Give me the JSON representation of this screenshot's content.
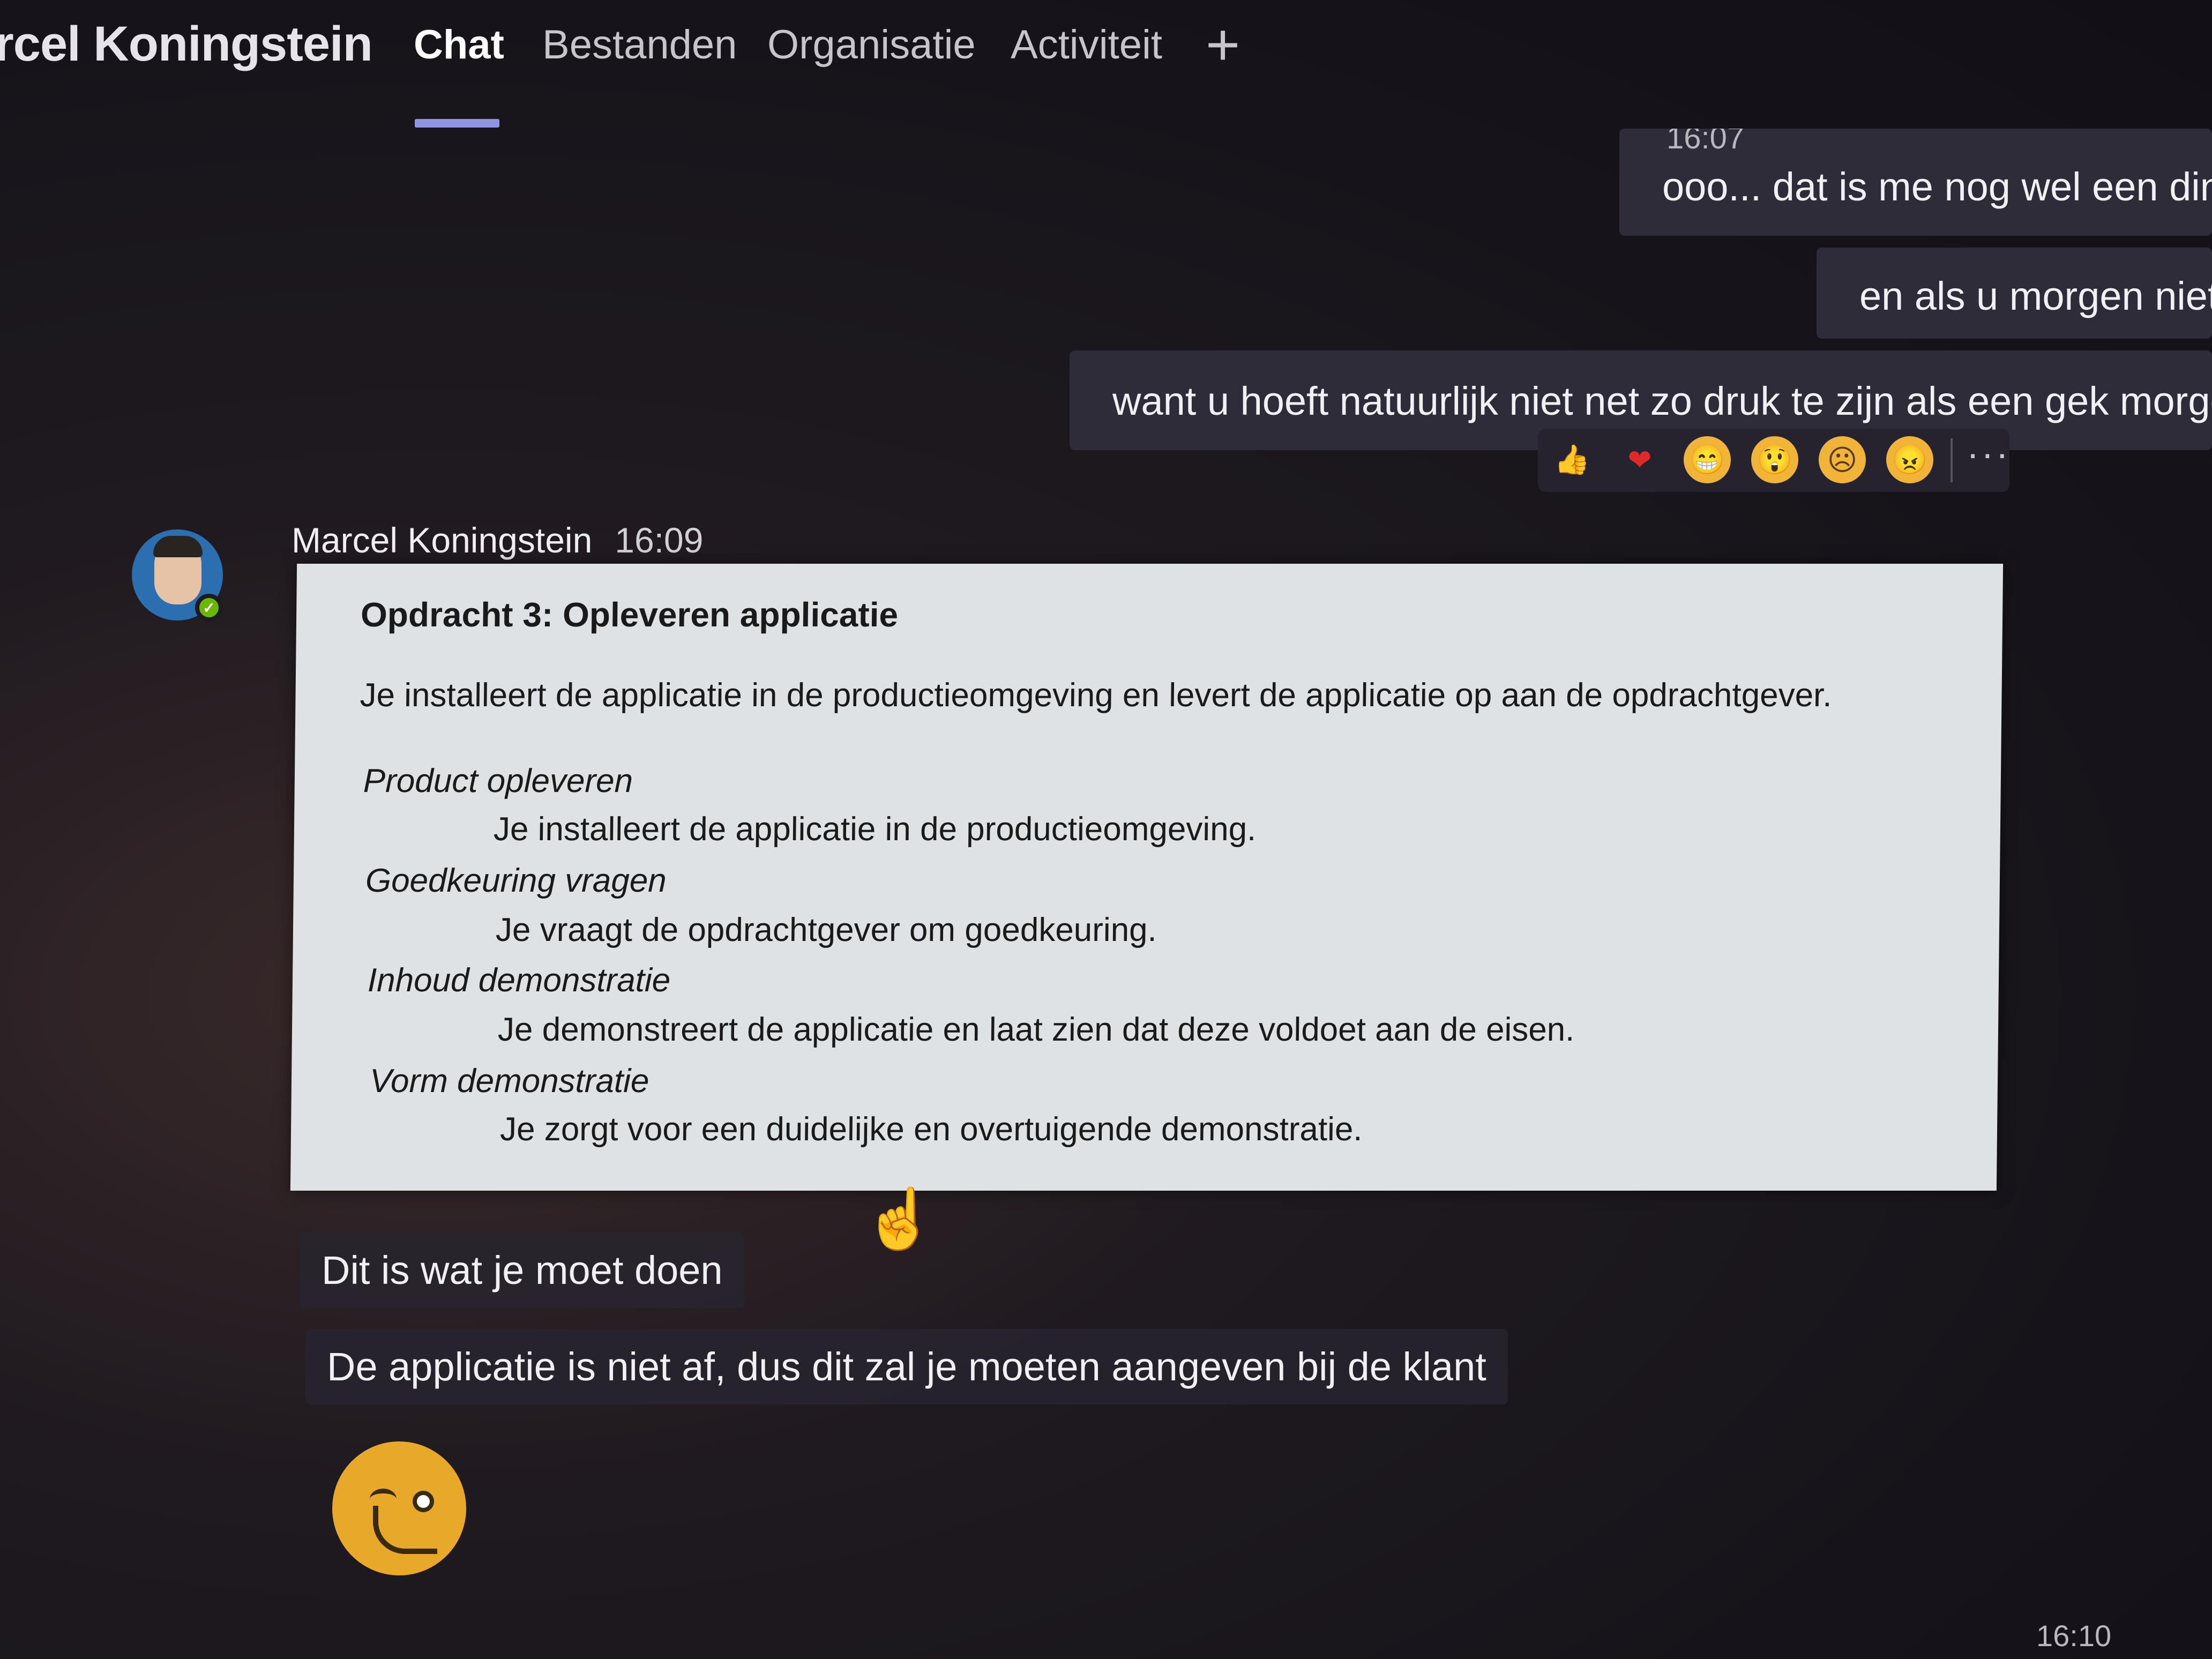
{
  "header": {
    "title": "rcel Koningstein",
    "tabs": [
      {
        "label": "Chat",
        "active": true
      },
      {
        "label": "Bestanden"
      },
      {
        "label": "Organisatie"
      },
      {
        "label": "Activiteit"
      }
    ],
    "add_tab_symbol": "+"
  },
  "messages_sent": [
    {
      "time": "16:07",
      "text": "ooo... dat is me nog wel een ding"
    },
    {
      "text": "en als u morgen niet"
    },
    {
      "text": "want u hoeft natuurlijk niet net zo druk te zijn als een gek morgen"
    }
  ],
  "reactions": {
    "items": [
      "thumbs-up-icon",
      "heart-icon",
      "laugh-icon",
      "surprised-icon",
      "sad-icon",
      "angry-icon"
    ],
    "more": "···"
  },
  "incoming": {
    "sender": "Marcel Koningstein",
    "time": "16:09",
    "document": {
      "heading": "Opdracht 3: Opleveren applicatie",
      "intro": "Je installeert de applicatie in de productieomgeving en levert de applicatie op aan de opdrachtgever.",
      "items": [
        {
          "label": "Product opleveren",
          "text": "Je installeert de applicatie in de productieomgeving."
        },
        {
          "label": "Goedkeuring vragen",
          "text": "Je vraagt de opdrachtgever om goedkeuring."
        },
        {
          "label": "Inhoud demonstratie",
          "text": "Je demonstreert de applicatie en laat zien dat deze voldoet aan de eisen."
        },
        {
          "label": "Vorm demonstratie",
          "text": "Je zorgt voor een duidelijke en overtuigende demonstratie."
        }
      ]
    },
    "message1": "Dit is wat je moet doen",
    "message2": "De applicatie is niet af, dus dit zal je moeten aangeven bij de klant",
    "emoji": "wink-emoji"
  },
  "bottom_time": "16:10",
  "colors": {
    "accent": "#8f95e0",
    "bubble": "#2f2c3a",
    "status_online": "#6bb700",
    "emoji": "#e8a92a"
  }
}
